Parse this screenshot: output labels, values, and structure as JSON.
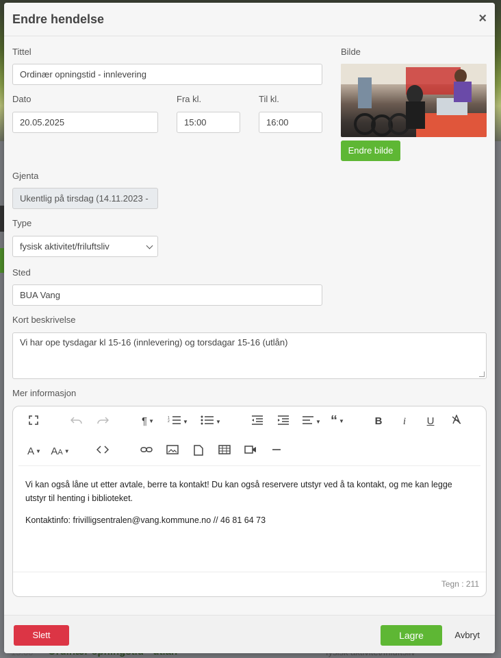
{
  "modal": {
    "title": "Endre hendelse",
    "close_glyph": "×"
  },
  "form": {
    "title_label": "Tittel",
    "title_value": "Ordinær opningstid - innlevering",
    "image_label": "Bilde",
    "change_image_label": "Endre bilde",
    "date_label": "Dato",
    "date_value": "20.05.2025",
    "from_label": "Fra kl.",
    "from_value": "15:00",
    "to_label": "Til kl.",
    "to_value": "16:00",
    "repeat_label": "Gjenta",
    "repeat_value": "Ukentlig på tirsdag (14.11.2023 -",
    "type_label": "Type",
    "type_value": "fysisk aktivitet/friluftsliv",
    "place_label": "Sted",
    "place_value": "BUA Vang",
    "short_desc_label": "Kort beskrivelse",
    "short_desc_value": "Vi har ope tysdagar kl 15-16 (innlevering) og torsdagar 15-16 (utlån)",
    "more_info_label": "Mer informasjon"
  },
  "editor": {
    "paragraph1": "Vi kan også låne ut etter avtale, berre ta kontakt! Du kan også reservere utstyr ved å ta kontakt, og me kan legge utstyr til henting i biblioteket.",
    "paragraph2": "Kontaktinfo: frivilligsentralen@vang.kommune.no // 46 81 64 73",
    "char_count": "Tegn : 211",
    "toolbar_icons": [
      "fullscreen-icon",
      "undo-icon",
      "redo-icon",
      "paragraph-format-icon",
      "ordered-list-icon",
      "unordered-list-icon",
      "outdent-icon",
      "indent-icon",
      "align-icon",
      "quote-icon",
      "bold-icon",
      "italic-icon",
      "underline-icon",
      "clear-format-icon",
      "font-family-icon",
      "font-size-icon",
      "code-view-icon",
      "link-icon",
      "image-icon",
      "file-icon",
      "table-icon",
      "video-icon",
      "horizontal-line-icon"
    ]
  },
  "footer": {
    "delete_label": "Slett",
    "save_label": "Lagre",
    "cancel_label": "Avbryt"
  },
  "background": {
    "row_time": "15:00",
    "row_title": "Ordinær opningstid - utlån",
    "row_type": "fysisk aktivitet/friluftsliv"
  },
  "colors": {
    "accent_green": "#5eb734",
    "danger_red": "#dc3545"
  }
}
